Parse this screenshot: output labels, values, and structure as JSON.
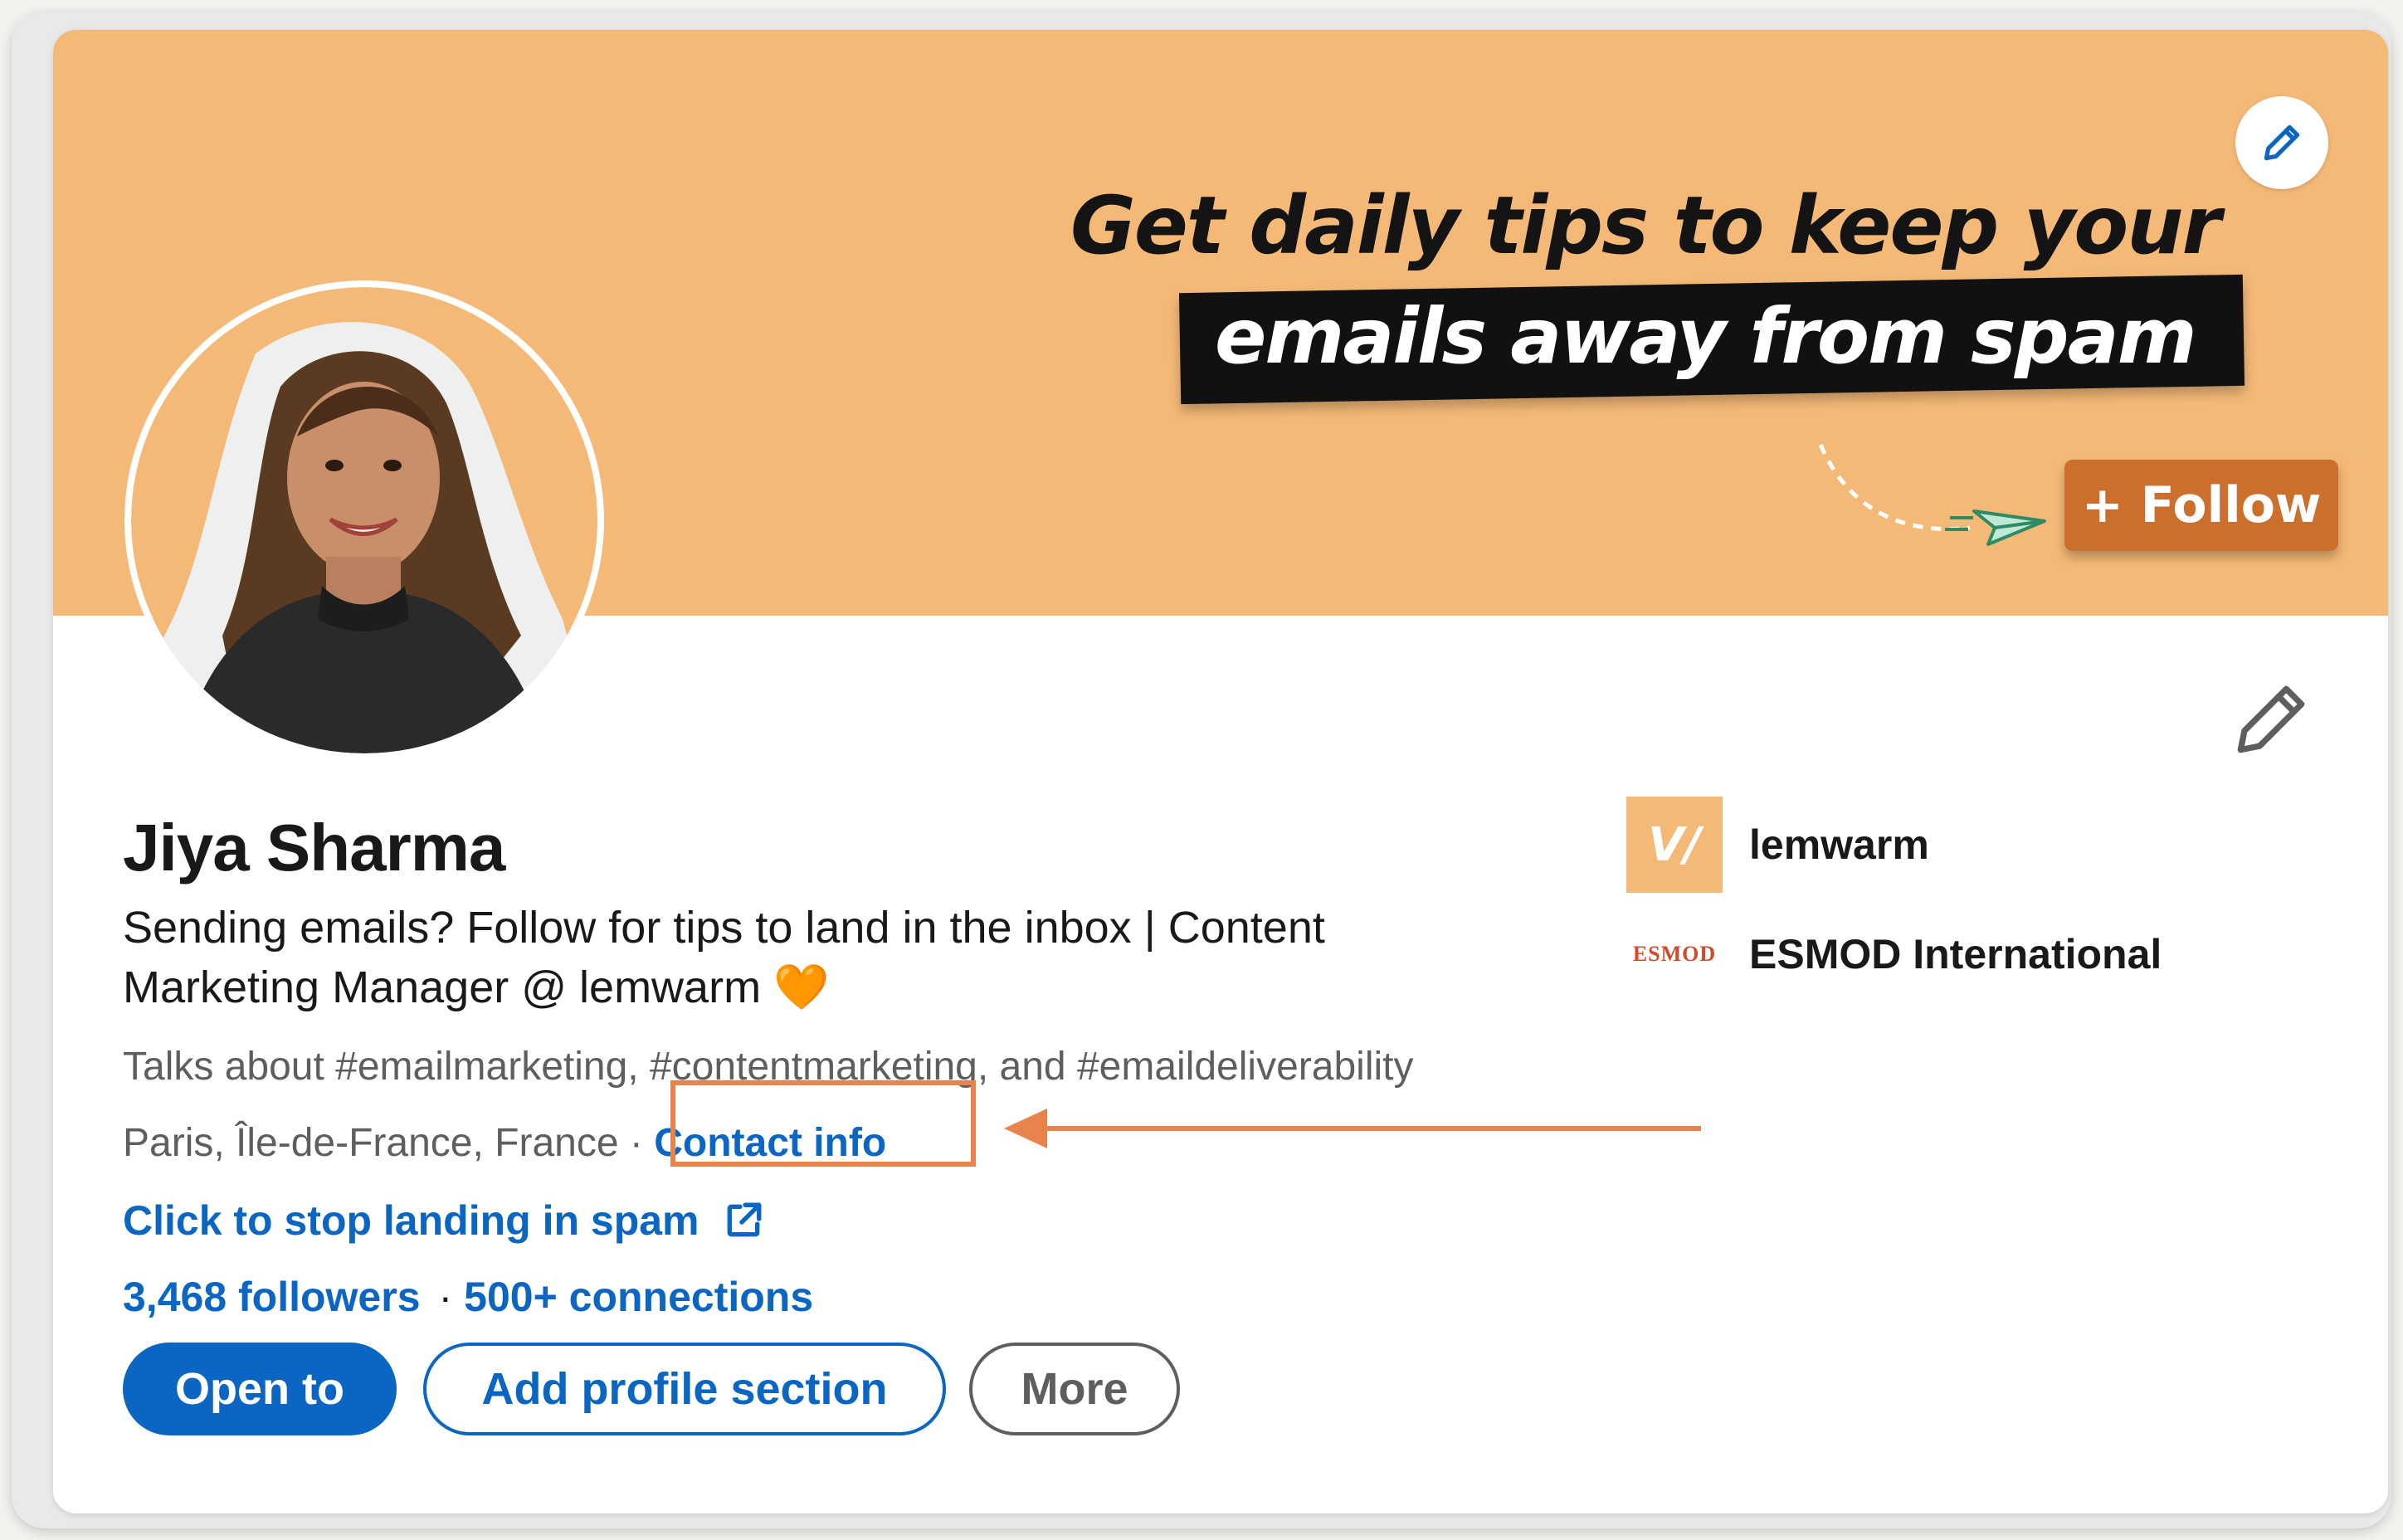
{
  "banner": {
    "title_line1": "Get daily tips to keep your",
    "title_line2": "emails away from spam",
    "follow_label": "+ Follow",
    "edit_icon": "pencil-icon"
  },
  "profile": {
    "name": "Jiya Sharma",
    "headline": "Sending emails? Follow for tips to land in the inbox | Content Marketing Manager @ lemwarm 🧡",
    "talks_about": "Talks about #emailmarketing, #contentmarketing, and #emaildeliverability",
    "location": "Paris, Île-de-France, France",
    "separator": "·",
    "contact_info": "Contact info",
    "website_label": "Click to stop landing in spam",
    "followers": "3,468 followers",
    "connections": "500+ connections"
  },
  "actions": {
    "open_to": "Open to",
    "add_section": "Add profile section",
    "more": "More"
  },
  "companies": [
    {
      "logo_text": "V/",
      "name": "lemwarm"
    },
    {
      "logo_text": "ESMOD",
      "name": "ESMOD International"
    }
  ],
  "colors": {
    "banner": "#f4b977",
    "link": "#0a66c2",
    "highlight": "#e8834c",
    "follow_button": "#cc6f2c"
  }
}
